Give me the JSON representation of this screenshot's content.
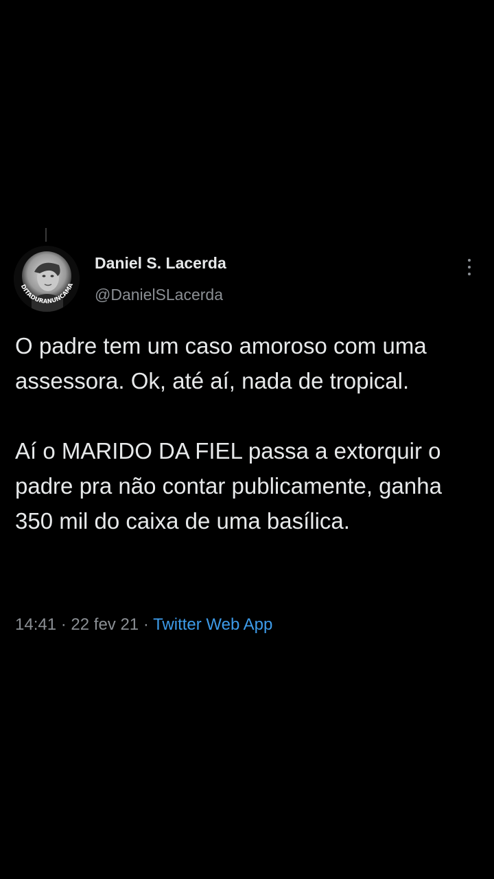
{
  "tweet": {
    "author_name": "Daniel S. Lacerda",
    "author_handle": "@DanielSLacerda",
    "avatar_badge_text": "DITADURANUNCAMAIS",
    "paragraphs": [
      "O padre tem um caso amoroso com uma assessora. Ok, até aí, nada de tropical.",
      "Aí o MARIDO DA FIEL passa a extorquir o padre pra não contar publicamente, ganha 350 mil do caixa de uma basílica."
    ],
    "time": "14:41",
    "separator": "·",
    "date": "22 fev 21",
    "source": "Twitter Web App"
  },
  "colors": {
    "background": "#000000",
    "text_primary": "#e7e9ea",
    "text_secondary": "#8b8f94",
    "link": "#3d9be9"
  },
  "icons": {
    "more": "vertical-ellipsis-icon"
  }
}
